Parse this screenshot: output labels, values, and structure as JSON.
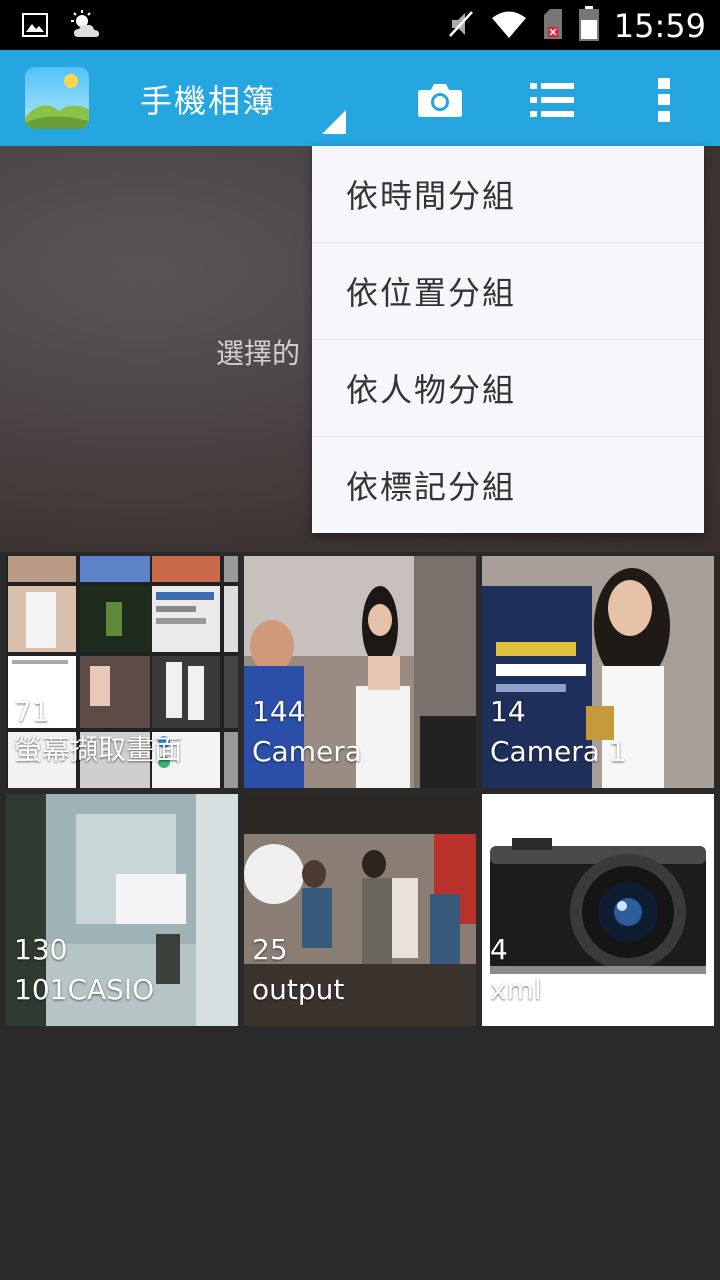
{
  "status_bar": {
    "time": "15:59",
    "icons": [
      "image-notification-icon",
      "weather-icon",
      "mute-icon",
      "wifi-icon",
      "no-sim-icon",
      "battery-icon"
    ]
  },
  "app_bar": {
    "title": "手機相簿",
    "actions": [
      "camera-icon",
      "list-view-icon",
      "overflow-menu-icon"
    ],
    "accent_color": "#26a6e1"
  },
  "hero": {
    "text": "選擇的"
  },
  "group_menu": {
    "items": [
      {
        "label": "依時間分組"
      },
      {
        "label": "依位置分組"
      },
      {
        "label": "依人物分組"
      },
      {
        "label": "依標記分組"
      }
    ]
  },
  "albums": [
    {
      "count": "71",
      "name": "螢幕擷取畫面"
    },
    {
      "count": "144",
      "name": "Camera"
    },
    {
      "count": "14",
      "name": "Camera 1"
    },
    {
      "count": "130",
      "name": "101CASIO"
    },
    {
      "count": "25",
      "name": "output"
    },
    {
      "count": "4",
      "name": "xml"
    }
  ]
}
